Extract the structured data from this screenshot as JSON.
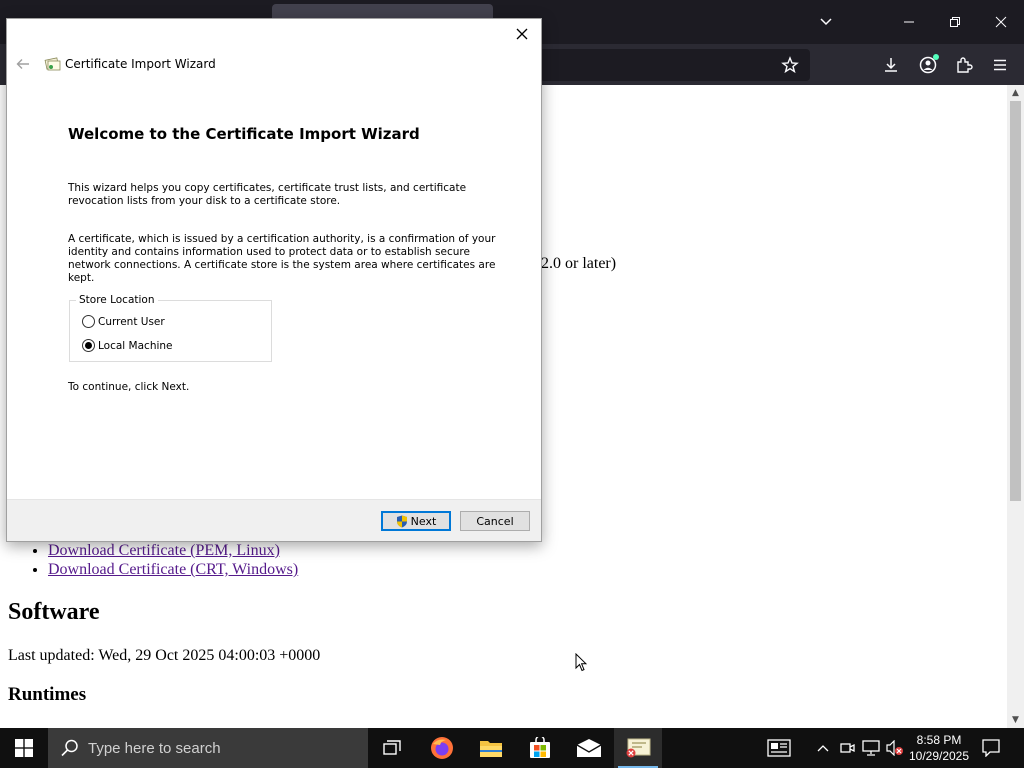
{
  "browser": {
    "tab_list_icon": "chevron-down-icon",
    "window_controls": [
      "minimize-icon",
      "restore-icon",
      "close-icon"
    ],
    "toolbar_icons": [
      "bookmark-star-icon",
      "download-icon",
      "account-icon",
      "extensions-icon",
      "menu-icon"
    ]
  },
  "page": {
    "partial_text": "2.0 or later)",
    "downloads": [
      "Download Certificate (PEM, Linux)",
      "Download Certificate (CRT, Windows)"
    ],
    "software_heading": "Software",
    "last_updated": "Last updated: Wed, 29 Oct 2025 04:00:03 +0000",
    "runtimes_heading": "Runtimes"
  },
  "dialog": {
    "title": "Certificate Import Wizard",
    "heading": "Welcome to the Certificate Import Wizard",
    "para1": "This wizard helps you copy certificates, certificate trust lists, and certificate revocation lists from your disk to a certificate store.",
    "para2": "A certificate, which is issued by a certification authority, is a confirmation of your identity and contains information used to protect data or to establish secure network connections. A certificate store is the system area where certificates are kept.",
    "store_location_label": "Store Location",
    "options": [
      {
        "label": "Current User",
        "selected": false
      },
      {
        "label": "Local Machine",
        "selected": true
      }
    ],
    "continue_text": "To continue, click Next.",
    "next_label": "Next",
    "cancel_label": "Cancel"
  },
  "taskbar": {
    "search_placeholder": "Type here to search",
    "apps": [
      "task-view-icon",
      "firefox-icon",
      "file-explorer-icon",
      "store-icon",
      "mail-icon",
      "certificate-manager-icon"
    ],
    "time": "8:58 PM",
    "date": "10/29/2025"
  }
}
